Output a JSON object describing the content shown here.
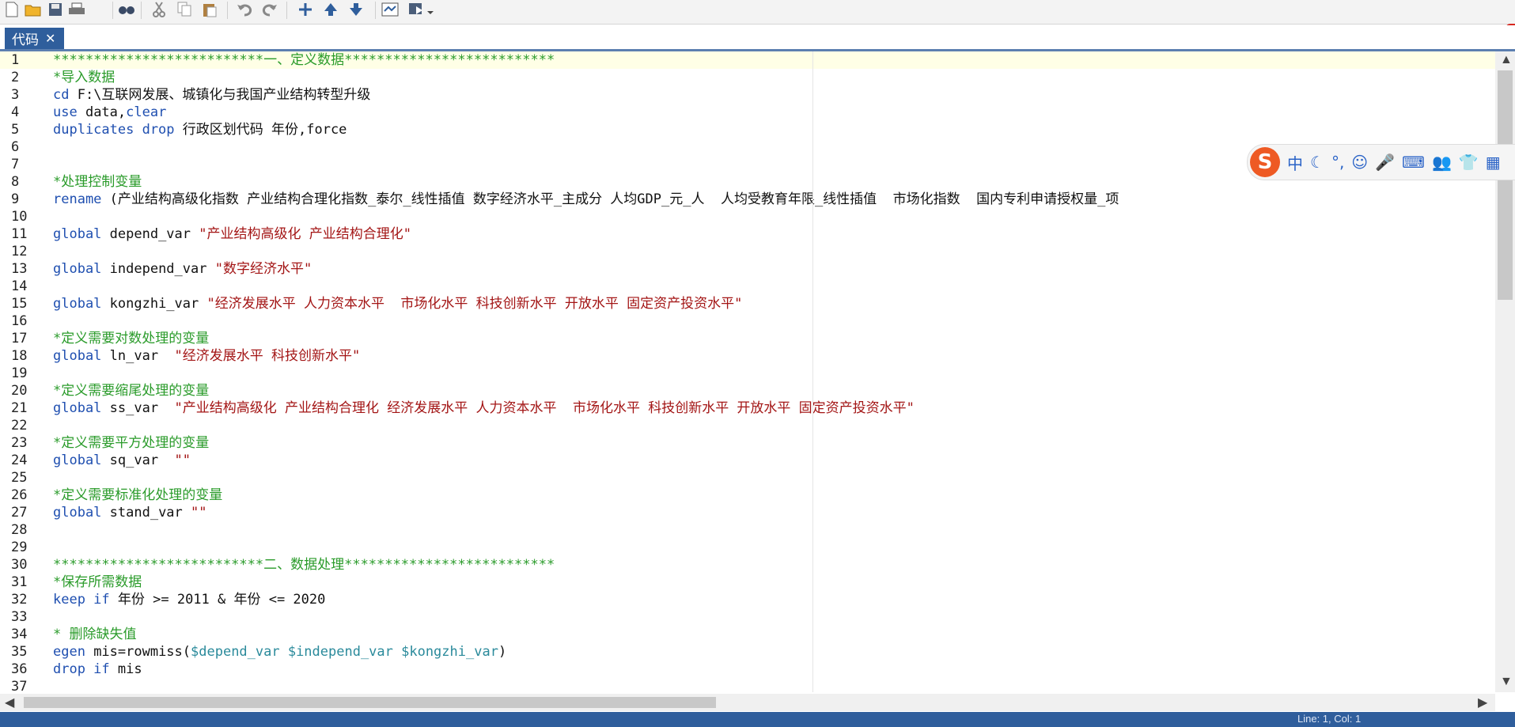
{
  "toolbar": {
    "buttons": [
      {
        "name": "new-file-icon"
      },
      {
        "name": "open-folder-icon"
      },
      {
        "name": "save-icon"
      },
      {
        "name": "print-icon"
      },
      {
        "name": "find-icon"
      },
      {
        "name": "cut-icon"
      },
      {
        "name": "copy-icon"
      },
      {
        "name": "paste-icon"
      },
      {
        "name": "undo-icon"
      },
      {
        "name": "redo-icon"
      },
      {
        "name": "bookmark-add-icon"
      },
      {
        "name": "bookmark-prev-icon"
      },
      {
        "name": "bookmark-next-icon"
      },
      {
        "name": "show-file-icon"
      },
      {
        "name": "do-run-icon"
      }
    ]
  },
  "tab": {
    "label": "代码",
    "close": "✕"
  },
  "editor": {
    "lines": [
      {
        "n": "1",
        "current": true,
        "segs": [
          {
            "t": "**************************一、定义数据**************************",
            "c": "comment"
          }
        ]
      },
      {
        "n": "2",
        "segs": [
          {
            "t": "*导入数据",
            "c": "comment"
          }
        ]
      },
      {
        "n": "3",
        "segs": [
          {
            "t": "cd",
            "c": "keyword"
          },
          {
            "t": " F:\\互联网发展、城镇化与我国产业结构转型升级",
            "c": "plain"
          }
        ]
      },
      {
        "n": "4",
        "segs": [
          {
            "t": "use",
            "c": "keyword"
          },
          {
            "t": " data,",
            "c": "plain"
          },
          {
            "t": "clear",
            "c": "keyword"
          }
        ]
      },
      {
        "n": "5",
        "segs": [
          {
            "t": "duplicates drop",
            "c": "keyword"
          },
          {
            "t": " 行政区划代码 年份,force",
            "c": "plain"
          }
        ]
      },
      {
        "n": "6",
        "segs": []
      },
      {
        "n": "7",
        "segs": []
      },
      {
        "n": "8",
        "segs": [
          {
            "t": "*处理控制变量",
            "c": "comment"
          }
        ]
      },
      {
        "n": "9",
        "segs": [
          {
            "t": "rename",
            "c": "keyword"
          },
          {
            "t": " (产业结构高级化指数 产业结构合理化指数_泰尔_线性插值 数字经济水平_主成分 人均GDP_元_人  人均受教育年限_线性插值  市场化指数  国内专利申请授权量_项",
            "c": "plain"
          }
        ]
      },
      {
        "n": "10",
        "segs": []
      },
      {
        "n": "11",
        "segs": [
          {
            "t": "global",
            "c": "keyword"
          },
          {
            "t": " depend_var ",
            "c": "plain"
          },
          {
            "t": "\"产业结构高级化 产业结构合理化\"",
            "c": "string"
          }
        ]
      },
      {
        "n": "12",
        "segs": []
      },
      {
        "n": "13",
        "segs": [
          {
            "t": "global",
            "c": "keyword"
          },
          {
            "t": " independ_var ",
            "c": "plain"
          },
          {
            "t": "\"数字经济水平\"",
            "c": "string"
          }
        ]
      },
      {
        "n": "14",
        "segs": []
      },
      {
        "n": "15",
        "segs": [
          {
            "t": "global",
            "c": "keyword"
          },
          {
            "t": " kongzhi_var ",
            "c": "plain"
          },
          {
            "t": "\"经济发展水平 人力资本水平  市场化水平 科技创新水平 开放水平 固定资产投资水平\"",
            "c": "string"
          }
        ]
      },
      {
        "n": "16",
        "segs": []
      },
      {
        "n": "17",
        "segs": [
          {
            "t": "*定义需要对数处理的变量",
            "c": "comment"
          }
        ]
      },
      {
        "n": "18",
        "segs": [
          {
            "t": "global",
            "c": "keyword"
          },
          {
            "t": " ln_var  ",
            "c": "plain"
          },
          {
            "t": "\"经济发展水平 科技创新水平\"",
            "c": "string"
          }
        ]
      },
      {
        "n": "19",
        "segs": []
      },
      {
        "n": "20",
        "segs": [
          {
            "t": "*定义需要缩尾处理的变量",
            "c": "comment"
          }
        ]
      },
      {
        "n": "21",
        "segs": [
          {
            "t": "global",
            "c": "keyword"
          },
          {
            "t": " ss_var  ",
            "c": "plain"
          },
          {
            "t": "\"产业结构高级化 产业结构合理化 经济发展水平 人力资本水平  市场化水平 科技创新水平 开放水平 固定资产投资水平\"",
            "c": "string"
          }
        ]
      },
      {
        "n": "22",
        "segs": []
      },
      {
        "n": "23",
        "segs": [
          {
            "t": "*定义需要平方处理的变量",
            "c": "comment"
          }
        ]
      },
      {
        "n": "24",
        "segs": [
          {
            "t": "global",
            "c": "keyword"
          },
          {
            "t": " sq_var  ",
            "c": "plain"
          },
          {
            "t": "\"\"",
            "c": "string"
          }
        ]
      },
      {
        "n": "25",
        "segs": []
      },
      {
        "n": "26",
        "segs": [
          {
            "t": "*定义需要标准化处理的变量",
            "c": "comment"
          }
        ]
      },
      {
        "n": "27",
        "segs": [
          {
            "t": "global",
            "c": "keyword"
          },
          {
            "t": " stand_var ",
            "c": "plain"
          },
          {
            "t": "\"\"",
            "c": "string"
          }
        ]
      },
      {
        "n": "28",
        "segs": []
      },
      {
        "n": "29",
        "segs": []
      },
      {
        "n": "30",
        "segs": [
          {
            "t": "**************************二、数据处理**************************",
            "c": "comment"
          }
        ]
      },
      {
        "n": "31",
        "segs": [
          {
            "t": "*保存所需数据",
            "c": "comment"
          }
        ]
      },
      {
        "n": "32",
        "segs": [
          {
            "t": "keep if",
            "c": "keyword"
          },
          {
            "t": " 年份 >= 2011 & 年份 <= 2020",
            "c": "plain"
          }
        ]
      },
      {
        "n": "33",
        "segs": []
      },
      {
        "n": "34",
        "segs": [
          {
            "t": "* 删除缺失值",
            "c": "comment"
          }
        ]
      },
      {
        "n": "35",
        "segs": [
          {
            "t": "egen",
            "c": "keyword"
          },
          {
            "t": " mis=rowmiss(",
            "c": "plain"
          },
          {
            "t": "$depend_var $independ_var $kongzhi_var",
            "c": "macro"
          },
          {
            "t": ")",
            "c": "plain"
          }
        ]
      },
      {
        "n": "36",
        "segs": [
          {
            "t": "drop if",
            "c": "keyword"
          },
          {
            "t": " mis",
            "c": "plain"
          }
        ]
      },
      {
        "n": "37",
        "segs": []
      }
    ]
  },
  "ime": {
    "logo": "S",
    "mode": "中",
    "items": [
      "☾",
      "°,",
      "☺",
      "🎤",
      "⌨",
      "👥",
      "👕",
      "▦"
    ]
  },
  "status": {
    "text": "Line: 1, Col: 1"
  }
}
